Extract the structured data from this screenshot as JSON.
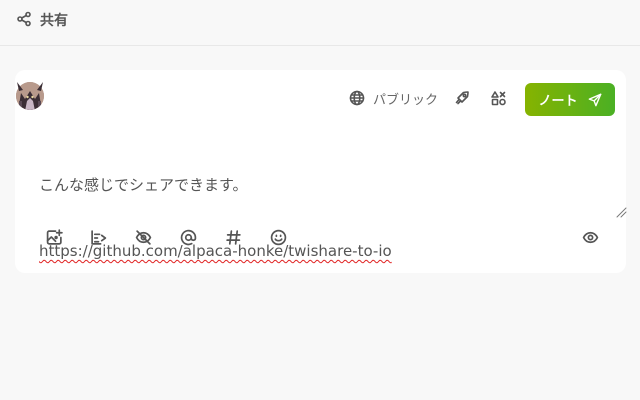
{
  "header": {
    "icon": "share-icon",
    "title": "共有"
  },
  "composer": {
    "avatar": "cat-avatar",
    "visibility_label": "パブリック",
    "visibility_icon": "globe-icon",
    "rocket_icon": "rocket-icon",
    "shapes_icon": "shapes-icon",
    "post_label": "ノート",
    "post_icon": "send-icon",
    "text_line1": "こんな感じでシェアできます。",
    "text_line2": "https://github.com/alpaca-honke/twishare-to-io"
  },
  "toolbar": {
    "items": [
      {
        "icon": "image-add-icon"
      },
      {
        "icon": "poll-icon"
      },
      {
        "icon": "eye-off-icon"
      },
      {
        "icon": "at-icon"
      },
      {
        "icon": "hashtag-icon"
      },
      {
        "icon": "emoji-icon"
      }
    ],
    "preview_icon": "eye-icon"
  },
  "colors": {
    "accent_start": "#86b300",
    "accent_end": "#4bb024",
    "background": "#f8f8f8",
    "card": "#ffffff",
    "spellcheck": "#e02020"
  }
}
